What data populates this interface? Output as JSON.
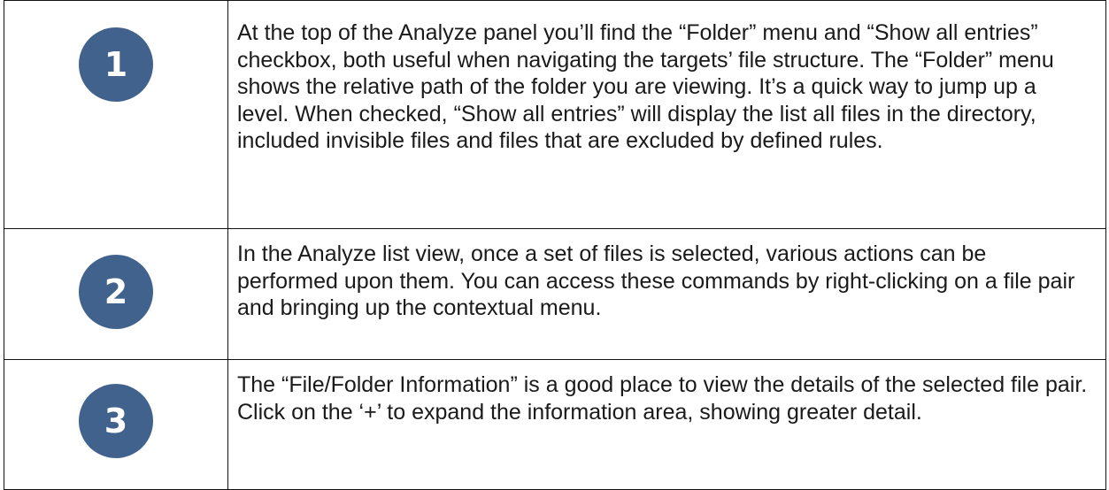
{
  "steps": [
    {
      "number": "1",
      "text": "At the top of the Analyze panel you’ll find the “Folder” menu and “Show all entries” checkbox, both useful when navigating the targets’ file structure. The “Folder” menu shows the relative path of the folder you are viewing. It’s a quick way to jump up a level. When checked, “Show all entries” will display the list all files in the directory, included invisible files and files that are excluded by defined rules."
    },
    {
      "number": "2",
      "text": "In the Analyze list view, once a set of files is selected, various actions can be performed upon them. You can access these commands by right-clicking on a file pair and bringing up the contextual menu."
    },
    {
      "number": "3",
      "text": "The “File/Folder Information” is a good place to view the details of the selected file pair. Click on the ‘+’ to expand the information area, showing greater detail."
    }
  ],
  "colors": {
    "badge": "#41628d",
    "badge_text": "#ffffff",
    "border": "#111111",
    "text": "#1a1a1a"
  }
}
